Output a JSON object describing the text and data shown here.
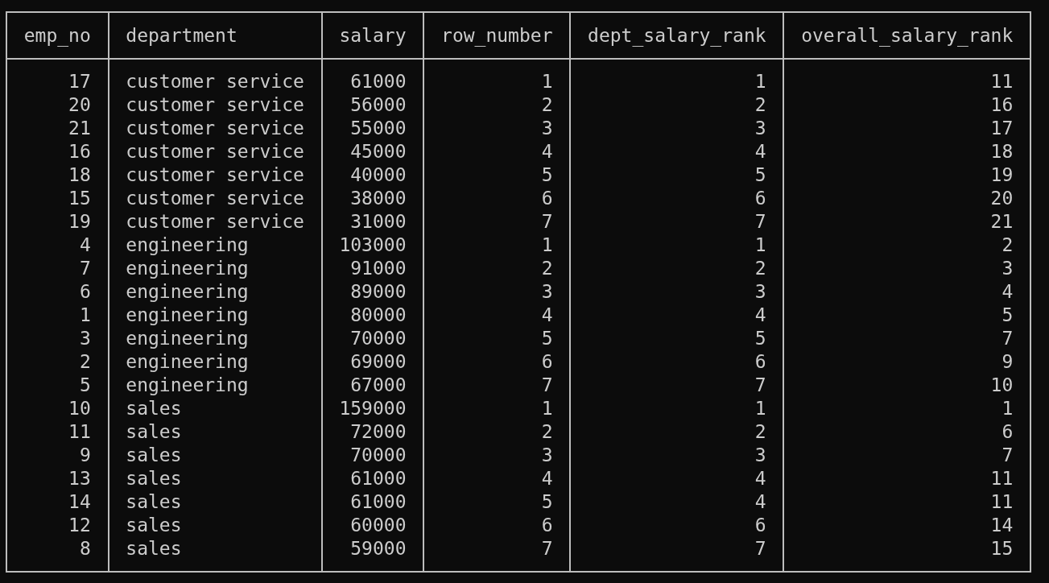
{
  "table": {
    "columns": [
      {
        "name": "emp_no",
        "kind": "number"
      },
      {
        "name": "department",
        "kind": "text"
      },
      {
        "name": "salary",
        "kind": "number"
      },
      {
        "name": "row_number",
        "kind": "number"
      },
      {
        "name": "dept_salary_rank",
        "kind": "number"
      },
      {
        "name": "overall_salary_rank",
        "kind": "number"
      }
    ],
    "rows": [
      [
        "17",
        "customer service",
        "61000",
        "1",
        "1",
        "11"
      ],
      [
        "20",
        "customer service",
        "56000",
        "2",
        "2",
        "16"
      ],
      [
        "21",
        "customer service",
        "55000",
        "3",
        "3",
        "17"
      ],
      [
        "16",
        "customer service",
        "45000",
        "4",
        "4",
        "18"
      ],
      [
        "18",
        "customer service",
        "40000",
        "5",
        "5",
        "19"
      ],
      [
        "15",
        "customer service",
        "38000",
        "6",
        "6",
        "20"
      ],
      [
        "19",
        "customer service",
        "31000",
        "7",
        "7",
        "21"
      ],
      [
        "4",
        "engineering",
        "103000",
        "1",
        "1",
        "2"
      ],
      [
        "7",
        "engineering",
        "91000",
        "2",
        "2",
        "3"
      ],
      [
        "6",
        "engineering",
        "89000",
        "3",
        "3",
        "4"
      ],
      [
        "1",
        "engineering",
        "80000",
        "4",
        "4",
        "5"
      ],
      [
        "3",
        "engineering",
        "70000",
        "5",
        "5",
        "7"
      ],
      [
        "2",
        "engineering",
        "69000",
        "6",
        "6",
        "9"
      ],
      [
        "5",
        "engineering",
        "67000",
        "7",
        "7",
        "10"
      ],
      [
        "10",
        "sales",
        "159000",
        "1",
        "1",
        "1"
      ],
      [
        "11",
        "sales",
        "72000",
        "2",
        "2",
        "6"
      ],
      [
        "9",
        "sales",
        "70000",
        "3",
        "3",
        "7"
      ],
      [
        "13",
        "sales",
        "61000",
        "4",
        "4",
        "11"
      ],
      [
        "14",
        "sales",
        "61000",
        "5",
        "4",
        "11"
      ],
      [
        "12",
        "sales",
        "60000",
        "6",
        "6",
        "14"
      ],
      [
        "8",
        "sales",
        "59000",
        "7",
        "7",
        "15"
      ]
    ]
  }
}
